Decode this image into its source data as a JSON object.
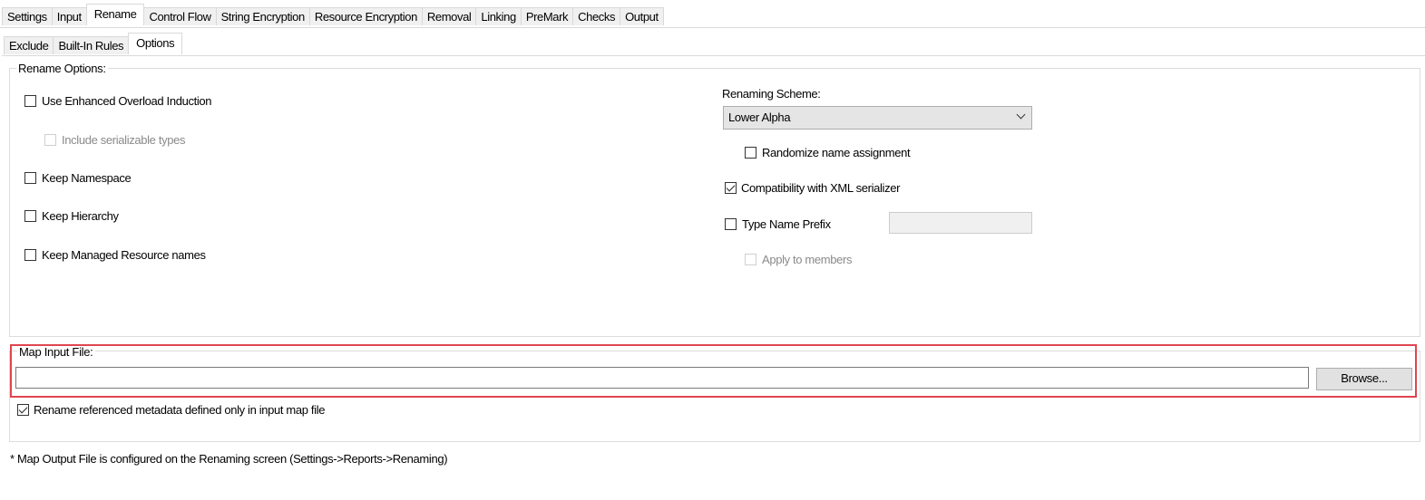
{
  "top_tabs": [
    "Settings",
    "Input",
    "Rename",
    "Control Flow",
    "String Encryption",
    "Resource Encryption",
    "Removal",
    "Linking",
    "PreMark",
    "Checks",
    "Output"
  ],
  "top_tab_active": "Rename",
  "sub_tabs": [
    "Exclude",
    "Built-In Rules",
    "Options"
  ],
  "sub_tab_active": "Options",
  "rename_options": {
    "legend": "Rename Options:",
    "use_enhanced_overload": {
      "label": "Use Enhanced Overload Induction",
      "checked": false
    },
    "include_serializable": {
      "label": "Include serializable types",
      "checked": false,
      "enabled": false
    },
    "keep_namespace": {
      "label": "Keep Namespace",
      "checked": false
    },
    "keep_hierarchy": {
      "label": "Keep Hierarchy",
      "checked": false
    },
    "keep_managed_resource": {
      "label": "Keep Managed Resource names",
      "checked": false
    },
    "renaming_scheme_label": "Renaming Scheme:",
    "renaming_scheme_value": "Lower Alpha",
    "randomize": {
      "label": "Randomize name assignment",
      "checked": false
    },
    "xml_compat": {
      "label": "Compatibility with XML serializer",
      "checked": true
    },
    "type_name_prefix": {
      "label": "Type Name Prefix",
      "checked": false,
      "value": ""
    },
    "apply_to_members": {
      "label": "Apply to members",
      "checked": false,
      "enabled": false
    }
  },
  "map_input": {
    "legend": "Map Input File:",
    "value": "",
    "browse_label": "Browse...",
    "rename_referenced": {
      "label": "Rename referenced metadata defined only in input map file",
      "checked": true
    }
  },
  "footnote": "* Map Output File is configured on the Renaming screen (Settings->Reports->Renaming)",
  "colors": {
    "highlight": "#e0454f",
    "tab_bg": "#f0f0f0",
    "border": "#d9d9d9"
  }
}
